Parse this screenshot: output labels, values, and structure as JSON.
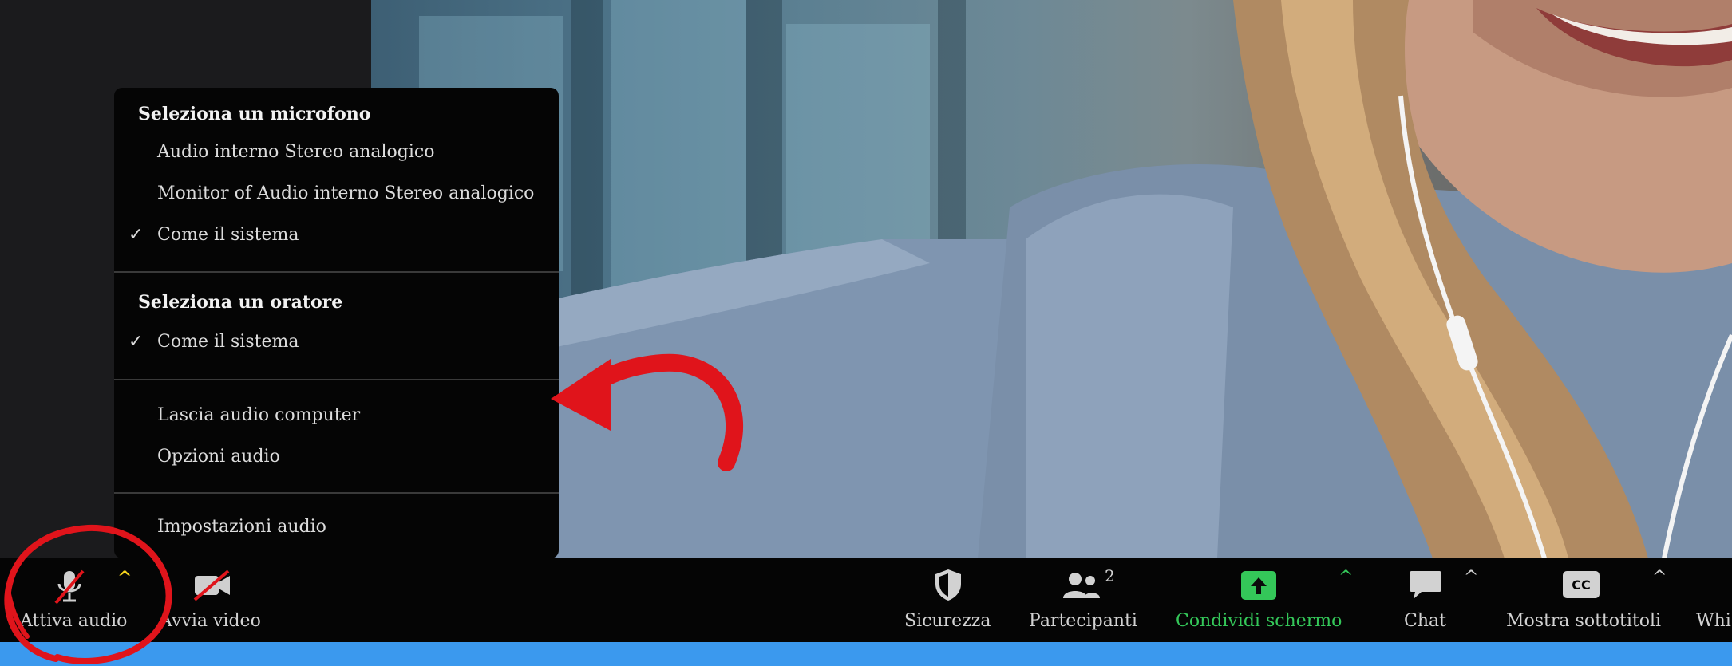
{
  "menu": {
    "mic_header": "Seleziona un microfono",
    "mic_items": [
      {
        "label": "Audio interno Stereo analogico",
        "checked": false
      },
      {
        "label": "Monitor of Audio interno Stereo analogico",
        "checked": false
      },
      {
        "label": "Come il sistema",
        "checked": true
      }
    ],
    "speaker_header": "Seleziona un oratore",
    "speaker_items": [
      {
        "label": "Come il sistema",
        "checked": true
      }
    ],
    "leave_audio": "Lascia audio computer",
    "audio_options": "Opzioni audio",
    "audio_settings": "Impostazioni audio",
    "check_glyph": "✓"
  },
  "toolbar": {
    "audio_label": "Attiva audio",
    "video_label": "Avvia video",
    "security_label": "Sicurezza",
    "participants_label": "Partecipanti",
    "participants_count": "2",
    "share_label": "Condividi schermo",
    "chat_label": "Chat",
    "captions_label": "Mostra sottotitoli",
    "whiteboard_label": "Whi",
    "cc_text": "CC",
    "caret": "^"
  },
  "icons": {
    "mic": "mic-muted-icon",
    "video": "video-off-icon",
    "security": "shield-icon",
    "participants": "people-icon",
    "share": "share-screen-icon",
    "chat": "chat-bubble-icon",
    "captions": "cc-icon"
  },
  "colors": {
    "accent_green": "#34c759",
    "caret_yellow": "#f7d51d",
    "annotation_red": "#e0141b",
    "bottom_bar": "#3b99ee"
  }
}
